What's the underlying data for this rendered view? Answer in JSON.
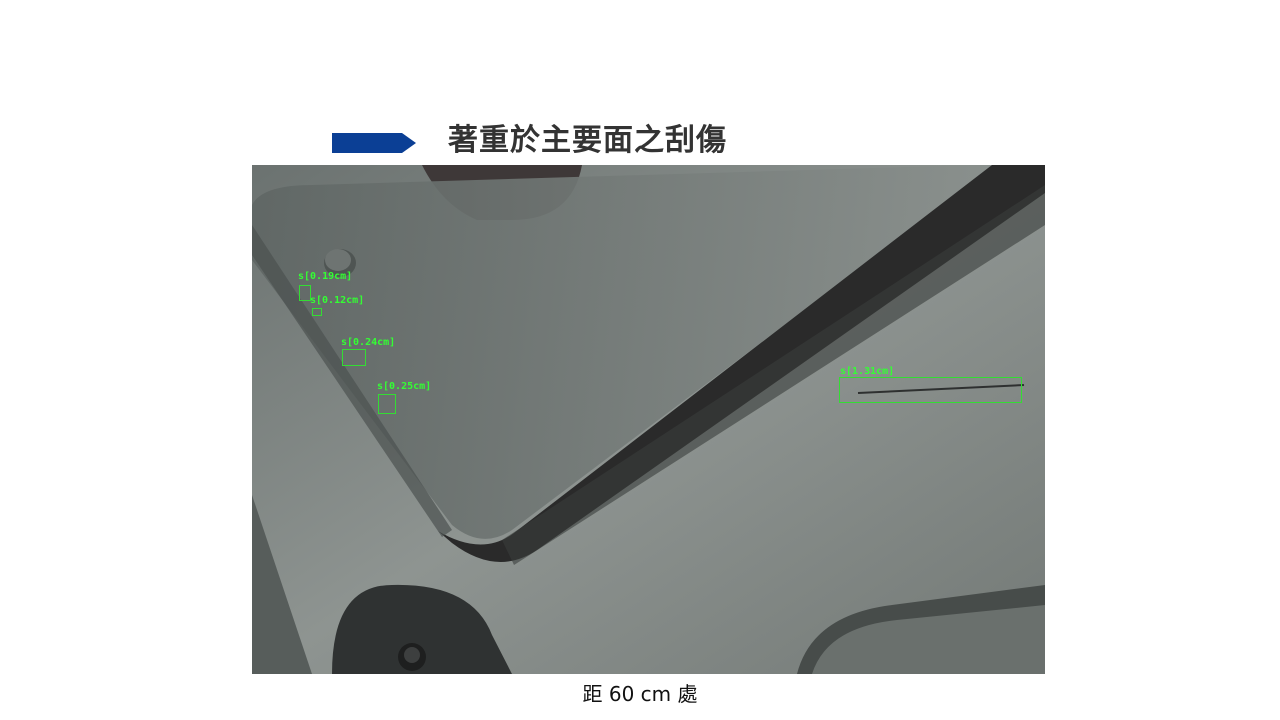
{
  "slide": {
    "title": "著重於主要面之刮傷",
    "caption": "距 60 cm 處",
    "accent_color": "#0b3f95"
  },
  "detections": [
    {
      "label": "s[0.19cm]"
    },
    {
      "label": "s[0.12cm]"
    },
    {
      "label": "s[0.24cm]"
    },
    {
      "label": "s[0.25cm]"
    },
    {
      "label": "s[1.31cm]"
    }
  ],
  "detection_color": "#33ff33"
}
